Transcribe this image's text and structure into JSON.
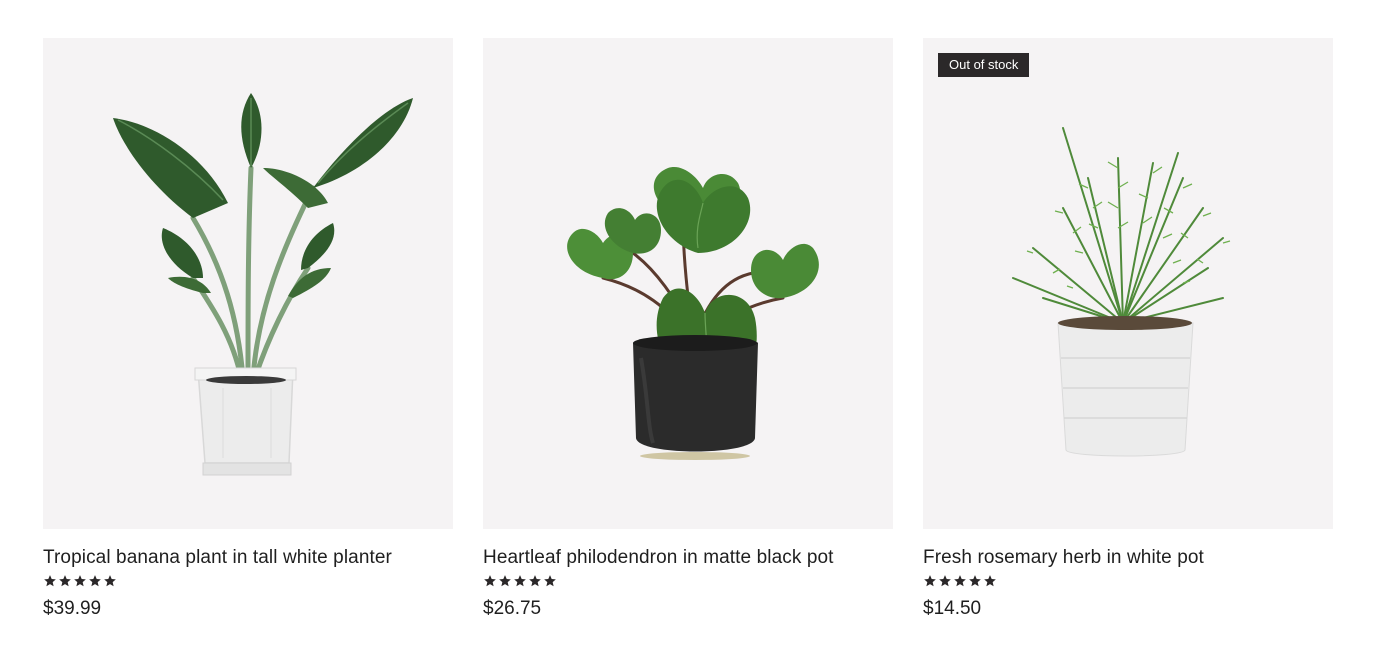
{
  "products": [
    {
      "title": "Tropical banana plant in tall white planter",
      "price": "$39.99",
      "rating": 5,
      "badge": "",
      "image_icon": "banana-plant-image"
    },
    {
      "title": "Heartleaf philodendron in matte black pot",
      "price": "$26.75",
      "rating": 5,
      "badge": "",
      "image_icon": "philodendron-image"
    },
    {
      "title": "Fresh rosemary herb in white pot",
      "price": "$14.50",
      "rating": 5,
      "badge": "Out of stock",
      "image_icon": "rosemary-image"
    }
  ],
  "colors": {
    "card_bg": "#f5f3f4",
    "badge_bg": "#2b2829",
    "text": "#1f1f1f",
    "star": "#2b2829"
  }
}
